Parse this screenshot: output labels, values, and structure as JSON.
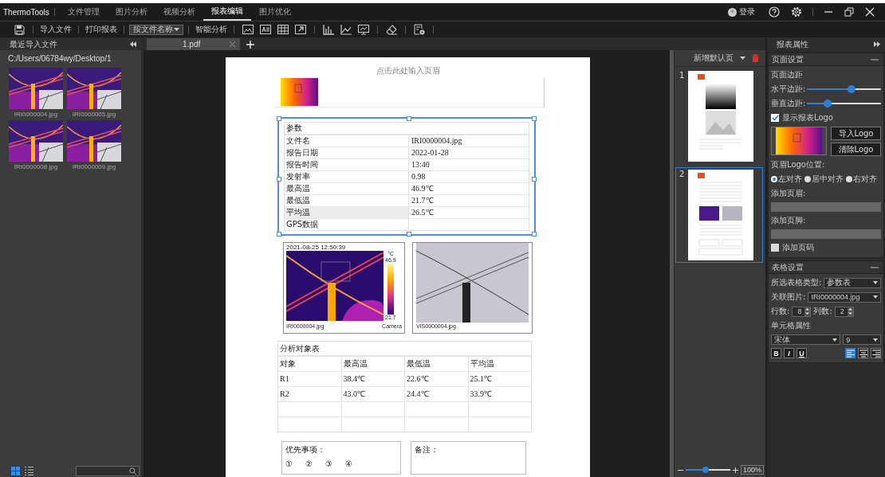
{
  "app": {
    "brand": "ThermoTools",
    "login": "登录",
    "tabs": [
      {
        "label": "文件管理",
        "selected": false
      },
      {
        "label": "图片分析",
        "selected": false
      },
      {
        "label": "视频分析",
        "selected": false
      },
      {
        "label": "报表编辑",
        "selected": true
      },
      {
        "label": "图片优化",
        "selected": false
      }
    ]
  },
  "toolbar": {
    "import": "导入文件",
    "print": "打印报表",
    "sort": "按文件名称",
    "smart": "智能分析"
  },
  "left_panel": {
    "title": "最近导入文件",
    "path": "C:/Users/06784wy/Desktop/1",
    "files": [
      {
        "name": "IRI0000004.jpg"
      },
      {
        "name": "IRI0000005.jpg"
      },
      {
        "name": "IRI0000008.jpg"
      },
      {
        "name": "IRI0000009.jpg"
      }
    ]
  },
  "doc_tabs": [
    {
      "label": "1.pdf",
      "selected": true
    }
  ],
  "document": {
    "header_placeholder": "点击此处输入页眉",
    "params_title": "参数",
    "params": [
      {
        "key": "文件名",
        "value": "IRI0000004.jpg",
        "selected": false
      },
      {
        "key": "报告日期",
        "value": "2022-01-28",
        "selected": false
      },
      {
        "key": "报告时间",
        "value": "13:40",
        "selected": false
      },
      {
        "key": "发射率",
        "value": "0.98",
        "selected": false
      },
      {
        "key": "最高温",
        "value": "46.9℃",
        "selected": false
      },
      {
        "key": "最低温",
        "value": "21.7℃",
        "selected": false
      },
      {
        "key": "平均温",
        "value": "26.5℃",
        "selected": true
      },
      {
        "key": "GPS数据",
        "selected": false
      }
    ],
    "thermal": {
      "timestamp": "2021-08-25 12:50:39",
      "unit": "°C",
      "max": "46.9",
      "min": "21.7",
      "file": "IRI0000004.jpg",
      "source": "Camera"
    },
    "visible": {
      "file": "VIS0000004.jpg"
    },
    "analysis": {
      "title": "分析对象表",
      "columns": [
        "对象",
        "最高温",
        "最低温",
        "平均温"
      ],
      "rows": [
        [
          "R1",
          "38.4℃",
          "22.6℃",
          "25.1℃"
        ],
        [
          "R2",
          "43.0℃",
          "24.4℃",
          "33.9℃"
        ]
      ]
    },
    "priority": {
      "label": "优先事项：",
      "options": [
        "①",
        "②",
        "③",
        "④"
      ]
    },
    "remarks": {
      "label": "备注："
    }
  },
  "pages": {
    "add": "新增默认页",
    "items": [
      {
        "number": "1",
        "selected": false
      },
      {
        "number": "2",
        "selected": true
      }
    ],
    "zoom": {
      "level": 0.45,
      "reading": "100%"
    }
  },
  "properties": {
    "title": "报表属性",
    "page_settings": {
      "title": "页面设置",
      "margins_label": "页面边距",
      "sliders": [
        {
          "label": "水平边距:",
          "level": 0.6
        },
        {
          "label": "垂直边距:",
          "level": 0.28
        }
      ],
      "show_logo": {
        "label": "显示报表Logo",
        "checked": true
      },
      "import_logo": "导入Logo",
      "clear_logo": "清除Logo",
      "logo_position_label": "页眉Logo位置:",
      "positions": [
        {
          "label": "左对齐",
          "selected": true
        },
        {
          "label": "居中对齐",
          "selected": false
        },
        {
          "label": "右对齐",
          "selected": false
        }
      ],
      "header_label": "添加页眉:",
      "footer_label": "添加页脚:",
      "page_number": {
        "label": "添加页码",
        "checked": false
      }
    },
    "table_settings": {
      "title": "表格设置",
      "type_label": "所选表格类型:",
      "type": "参数表",
      "image_label": "关联图片:",
      "image": "IRI0000004.jpg",
      "rows_label": "行数:",
      "rows": "8",
      "cols_label": "列数:",
      "cols": "2",
      "cell_label": "单元格属性",
      "font": "宋体",
      "size": "9",
      "formats": [
        "B",
        "I",
        "U"
      ],
      "aligns": [
        {
          "kind": "left",
          "selected": true
        },
        {
          "kind": "center",
          "selected": false
        },
        {
          "kind": "right",
          "selected": false
        }
      ]
    }
  }
}
